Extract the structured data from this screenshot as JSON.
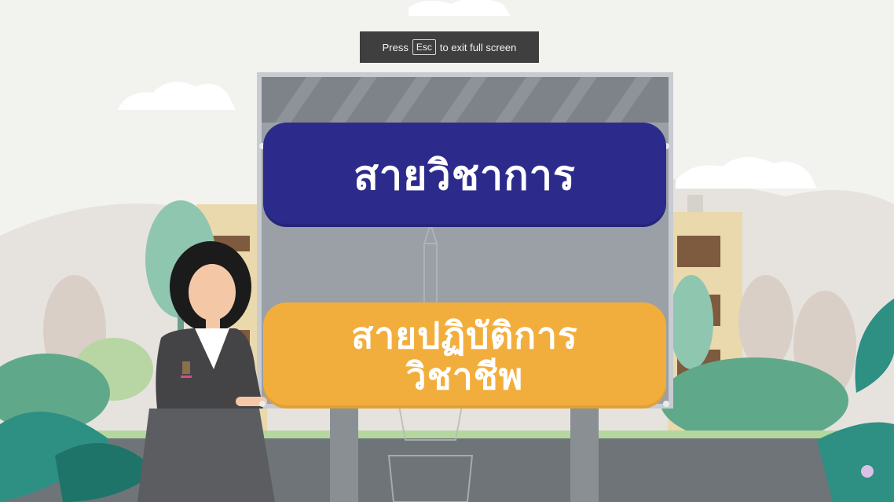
{
  "fullscreen_notice": {
    "press": "Press",
    "key": "Esc",
    "rest": "to exit full screen"
  },
  "board": {
    "option_1": "สายวิชาการ",
    "option_2_line_1": "สายปฏิบัติการ",
    "option_2_line_2": "วิชาชีพ"
  },
  "colors": {
    "blue_pill": "#2c2b8c",
    "orange_pill": "#f2ae3d",
    "board_gray": "#9aa0a6",
    "notice_bg": "#3f3f3f"
  },
  "icons": [
    "presenter-character",
    "temple-watermark",
    "leaf-plant",
    "tree",
    "building"
  ]
}
